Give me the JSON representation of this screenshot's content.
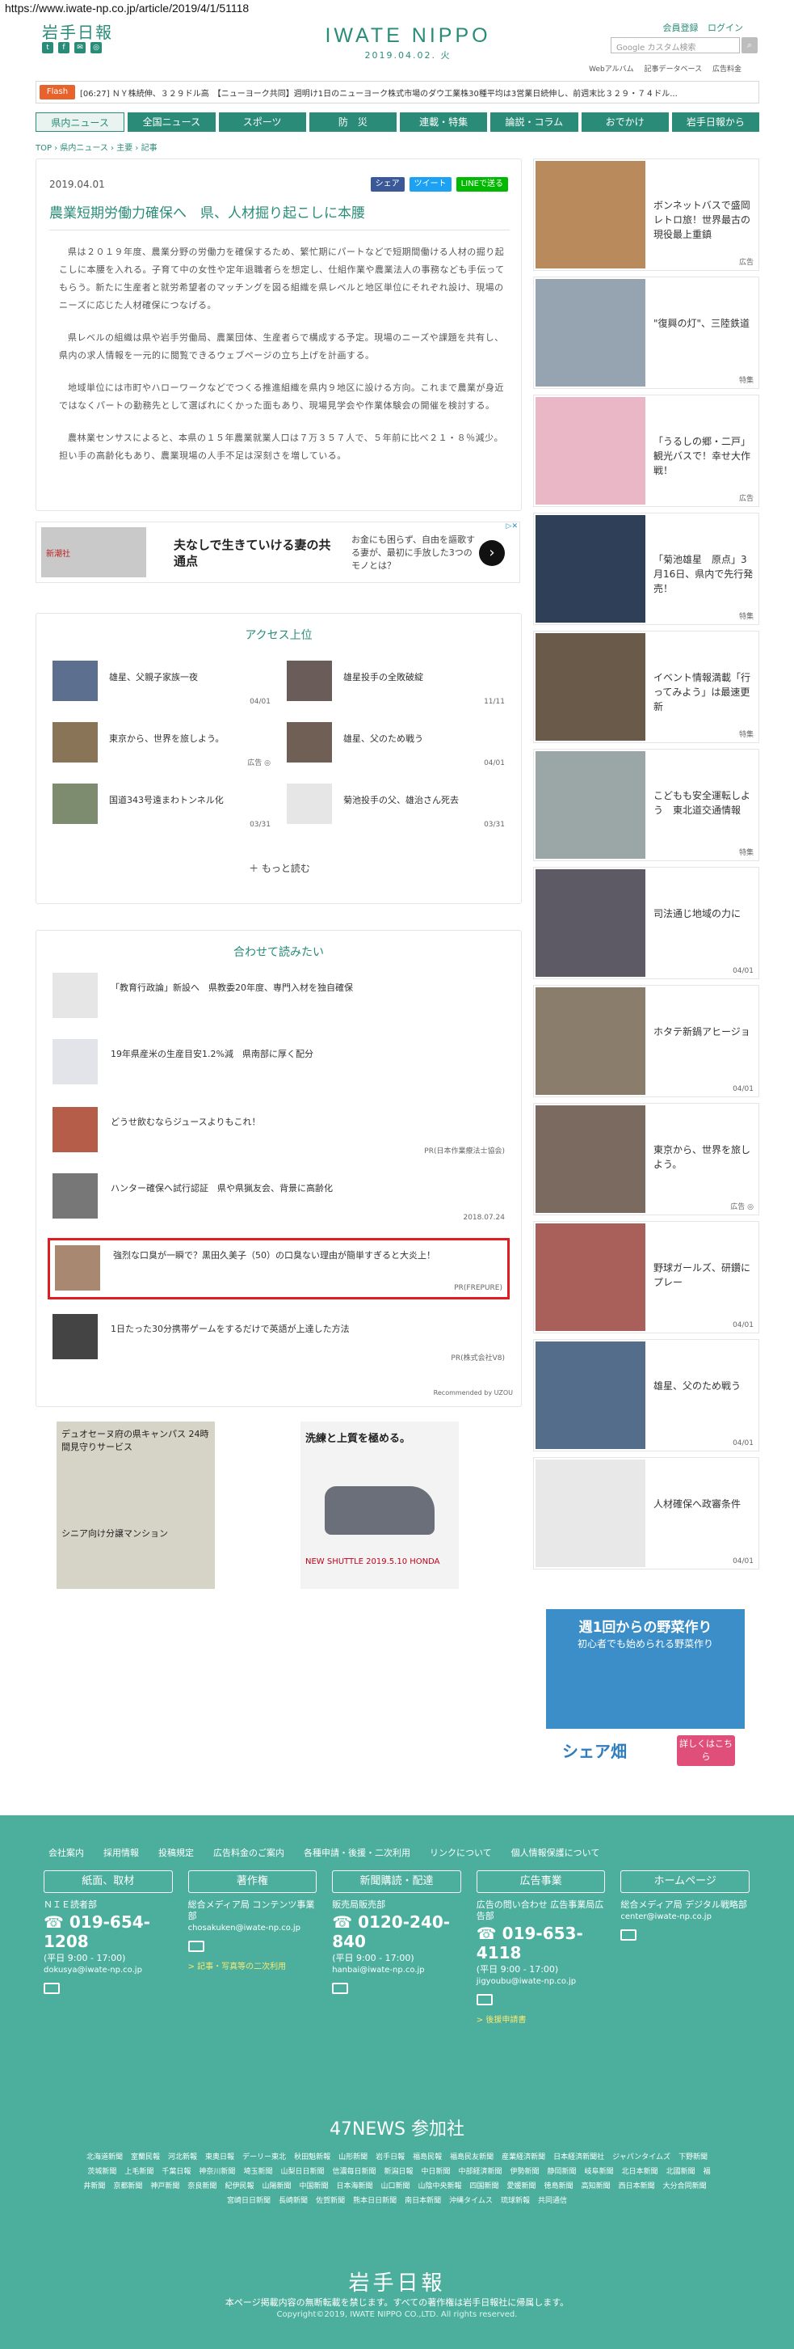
{
  "browser": {
    "url": "https://www.iwate-np.co.jp/article/2019/4/1/51118"
  },
  "header": {
    "logo": "岩手日報",
    "site_title": "IWATE NIPPO",
    "date": "2019.04.02. 火",
    "account": [
      "会員登録",
      "ログイン"
    ],
    "search_placeholder": "Google カスタム検索",
    "sublinks": [
      "Webアルバム",
      "記事データベース",
      "広告料金"
    ],
    "social_icons": [
      "twitter-icon",
      "facebook-icon",
      "mail-icon",
      "instagram-icon"
    ]
  },
  "flash": {
    "label": "Flash",
    "text": "[06:27] ＮＹ株続伸、３２９ドル高　【ニューヨーク共同】週明け1日のニューヨーク株式市場のダウ工業株30種平均は3営業日続伸し、前週末比３２９・７４ドル..."
  },
  "nav": [
    "県内ニュース",
    "全国ニュース",
    "スポーツ",
    "防　災",
    "連載・特集",
    "論説・コラム",
    "おでかけ",
    "岩手日報から"
  ],
  "breadcrumb": [
    "TOP",
    "県内ニュース",
    "主要",
    "記事"
  ],
  "article": {
    "date": "2019.04.01",
    "share": [
      "シェア",
      "ツイート",
      "LINEで送る"
    ],
    "title": "農業短期労働力確保へ　県、人材掘り起こしに本腰",
    "paragraphs": [
      "県は２０１９年度、農業分野の労働力を確保するため、繁忙期にパートなどで短期間働ける人材の掘り起こしに本腰を入れる。子育て中の女性や定年退職者らを想定し、仕組作業や農業法人の事務なども手伝ってもらう。新たに生産者と就労希望者のマッチングを図る組織を県レベルと地区単位にそれぞれ設け、現場のニーズに応じた人材確保につなげる。",
      "県レベルの組織は県や岩手労働局、農業団体、生産者らで構成する予定。現場のニーズや課題を共有し、県内の求人情報を一元的に閲覧できるウェブページの立ち上げを計画する。",
      "地域単位には市町やハローワークなどでつくる推進組織を県内９地区に設ける方向。これまで農業が身近ではなくパートの勤務先として選ばれにくかった面もあり、現場見学会や作業体験会の開催を検討する。",
      "農林業センサスによると、本県の１５年農業就業人口は７万３５７人で、５年前に比べ２１・８％減少。担い手の高齢化もあり、農業現場の人手不足は深刻さを増している。"
    ]
  },
  "ad_banner": {
    "brand": "新潮社",
    "headline": "夫なしで生きていける妻の共通点",
    "sub": "お金にも困らず、自由を謳歌する妻が、最初に手放した3つのモノとは？",
    "badge": "▷✕"
  },
  "access": {
    "title": "アクセス上位",
    "items": [
      {
        "text": "雄星、父親子家族一夜",
        "date": "04/01"
      },
      {
        "text": "雄星投手の全敗破綻",
        "date": "11/11"
      },
      {
        "text": "東京から、世界を旅しよう。",
        "date": "広告 ◎"
      },
      {
        "text": "雄星、父のため戦う",
        "date": "04/01"
      },
      {
        "text": "国道343号遠まわトンネル化",
        "date": "03/31"
      },
      {
        "text": "菊池投手の父、雄治さん死去",
        "date": "03/31"
      }
    ],
    "more": "もっと読む"
  },
  "related": {
    "title": "合わせて読みたい",
    "items": [
      {
        "text": "「教育行政論」新設へ　県教委20年度、専門入材を独自確保",
        "meta": ""
      },
      {
        "text": "19年県産米の生産目安1.2%減　県南部に厚く配分",
        "meta": ""
      },
      {
        "text": "どうせ飲むならジュースよりもこれ！",
        "meta": "PR(日本作業療法士協会)"
      },
      {
        "text": "ハンター確保へ試行認証　県や県猟友会、背景に高齢化",
        "meta": "2018.07.24"
      },
      {
        "text": "強烈な口臭が一瞬で？黒田久美子（50）の口臭ない理由が簡単すぎると大炎上！",
        "meta": "PR(FREPURE)"
      },
      {
        "text": "1日たった30分携帯ゲームをするだけで英語が上達した方法",
        "meta": "PR(株式会社V8)"
      }
    ],
    "recommend": "Recommended by UZOU"
  },
  "bottom_ads": [
    {
      "label": "デュオセーヌ府の県キャンパス 24時間見守りサービス",
      "sub": "シニア向け分譲マンション"
    },
    {
      "label": "洗練と上質を極める。",
      "sub": "NEW SHUTTLE 2019.5.10 HONDA"
    }
  ],
  "sidebar": [
    {
      "text": "ボンネットバスで盛岡レトロ旅！世界最古の現役最上重鎮",
      "meta": "広告"
    },
    {
      "text": "\"復興の灯\"、三陸鉄道",
      "meta": "特集"
    },
    {
      "text": "「うるしの郷・二戸」観光バスで！幸せ大作戦！",
      "meta": "広告"
    },
    {
      "text": "「菊池雄星　原点」3月16日、県内で先行発売！",
      "meta": "特集"
    },
    {
      "text": "イベント情報満載「行ってみよう」は最速更新",
      "meta": "特集"
    },
    {
      "text": "こどもも安全運転しよう　東北道交通情報",
      "meta": "特集"
    },
    {
      "text": "司法通じ地域の力に",
      "meta": "04/01"
    },
    {
      "text": "ホタテ新鍋アヒージョ",
      "meta": "04/01"
    },
    {
      "text": "東京から、世界を旅しよう。",
      "meta": "広告 ◎"
    },
    {
      "text": "野球ガールズ、研鑽にプレー",
      "meta": "04/01"
    },
    {
      "text": "雄星、父のため戦う",
      "meta": "04/01"
    },
    {
      "text": "人材確保へ政審条件",
      "meta": "04/01"
    }
  ],
  "side_ad": {
    "headline": "週1回からの野菜作り",
    "sub": "初心者でも始められる野菜作り",
    "brand": "シェア畑",
    "button": "詳しくはこちら"
  },
  "footer": {
    "links": [
      "会社案内",
      "採用情報",
      "投稿規定",
      "広告料金のご案内",
      "各種申請・後援・二次利用",
      "リンクについて",
      "個人情報保護について"
    ],
    "columns": [
      {
        "head": "紙面、取材",
        "dept": "ＮＩＥ読者部",
        "phone": "019-654-1208",
        "hours": "(平日 9:00 - 17:00)",
        "email": "dokusya@iwate-np.co.jp",
        "extra": ""
      },
      {
        "head": "著作権",
        "dept": "総合メディア局 コンテンツ事業部",
        "phone": "",
        "hours": "",
        "email": "chosakuken@iwate-np.co.jp",
        "extra": "> 記事・写真等の二次利用"
      },
      {
        "head": "新聞購読・配達",
        "dept": "販売局販売部",
        "phone": "0120-240-840",
        "hours": "(平日 9:00 - 17:00)",
        "email": "hanbai@iwate-np.co.jp",
        "extra": ""
      },
      {
        "head": "広告事業",
        "dept": "広告の問い合わせ 広告事業局広告部",
        "phone": "019-653-4118",
        "hours": "(平日 9:00 - 17:00)",
        "email": "jigyoubu@iwate-np.co.jp",
        "extra": "> 後援申請書"
      },
      {
        "head": "ホームページ",
        "dept": "総合メディア局 デジタル戦略部",
        "phone": "",
        "hours": "",
        "email": "center@iwate-np.co.jp",
        "extra": ""
      }
    ],
    "news47": "47NEWS 参加社",
    "papers": [
      "北海道新聞",
      "室蘭民報",
      "河北新報",
      "東奥日報",
      "デーリー東北",
      "秋田魁新報",
      "山形新聞",
      "岩手日報",
      "福島民報",
      "福島民友新聞",
      "産業経済新聞",
      "日本経済新聞社",
      "ジャパンタイムズ",
      "下野新聞",
      "茨城新聞",
      "上毛新聞",
      "千葉日報",
      "神奈川新聞",
      "埼玉新聞",
      "山梨日日新聞",
      "信濃毎日新聞",
      "新潟日報",
      "中日新聞",
      "中部経済新聞",
      "伊勢新聞",
      "静岡新聞",
      "岐阜新聞",
      "北日本新聞",
      "北國新聞",
      "福井新聞",
      "京都新聞",
      "神戸新聞",
      "奈良新聞",
      "紀伊民報",
      "山陽新聞",
      "中国新聞",
      "日本海新聞",
      "山口新聞",
      "山陰中央新報",
      "四国新聞",
      "愛媛新聞",
      "徳島新聞",
      "高知新聞",
      "西日本新聞",
      "大分合同新聞",
      "宮崎日日新聞",
      "長崎新聞",
      "佐賀新聞",
      "熊本日日新聞",
      "南日本新聞",
      "沖縄タイムス",
      "琉球新報",
      "共同通信"
    ],
    "logo": "岩手日報",
    "note": "本ページ掲載内容の無断転載を禁じます。すべての著作権は岩手日報社に帰属します。",
    "copyright": "Copyright©2019, IWATE NIPPO CO.,LTD. All rights reserved."
  }
}
